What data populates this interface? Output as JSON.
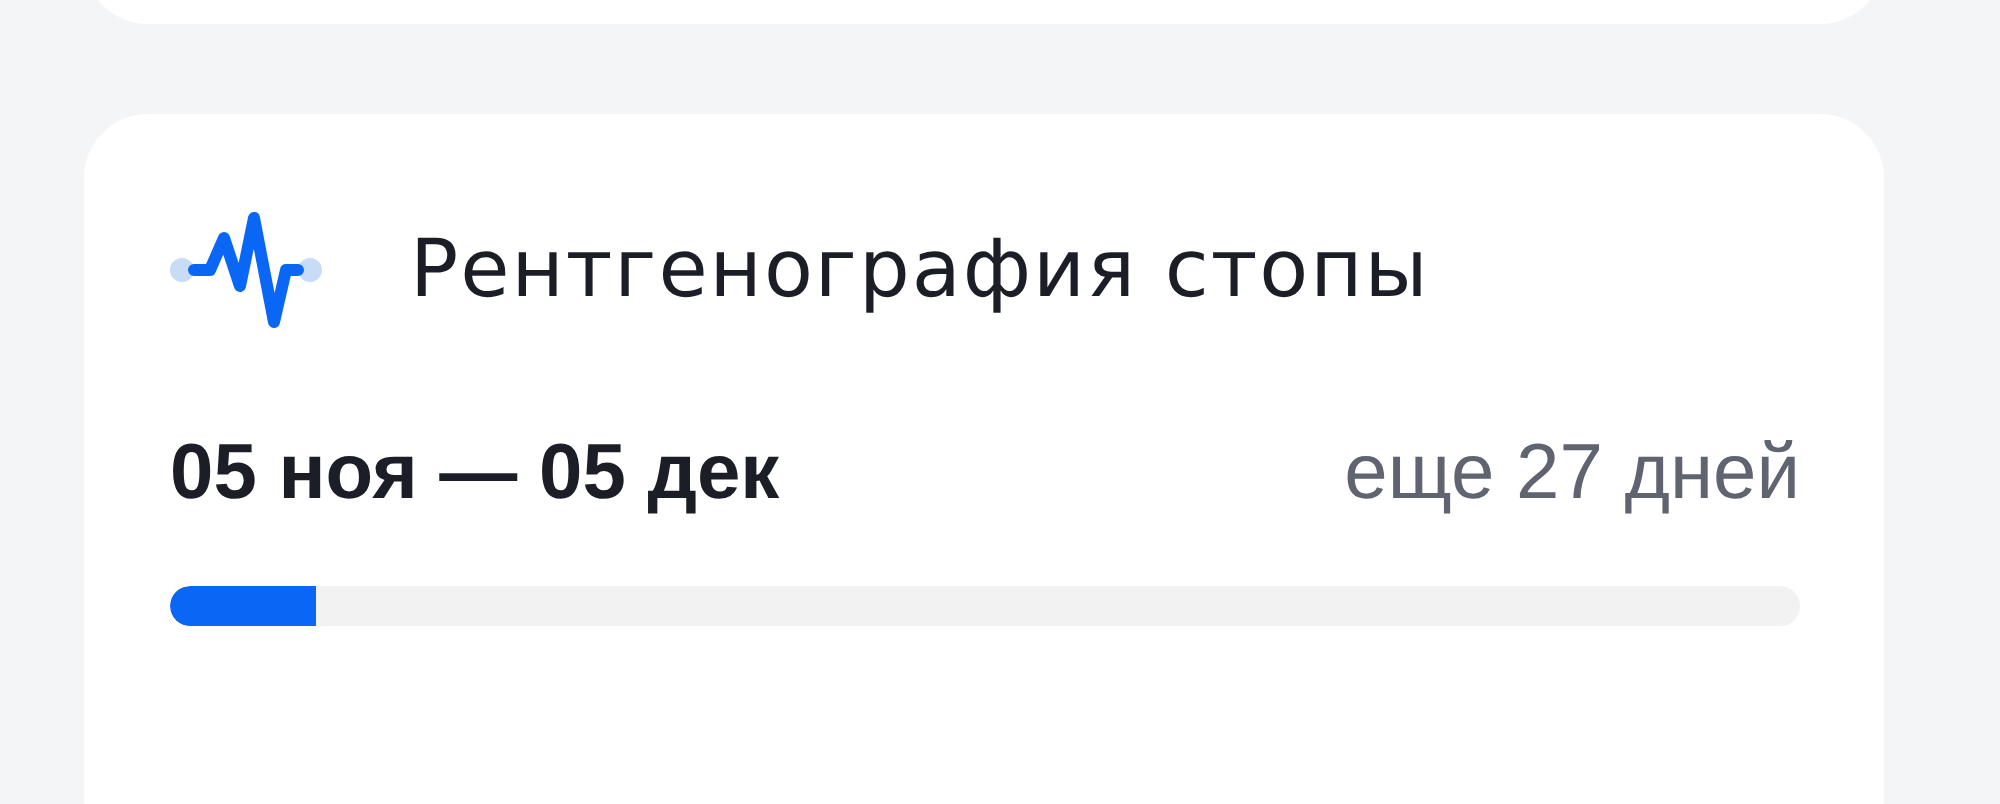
{
  "card": {
    "title": "Рентгенография стопы",
    "period": "05 ноя — 05 дек",
    "remaining": "еще 27 дней",
    "progress": {
      "level": 0.09
    }
  }
}
